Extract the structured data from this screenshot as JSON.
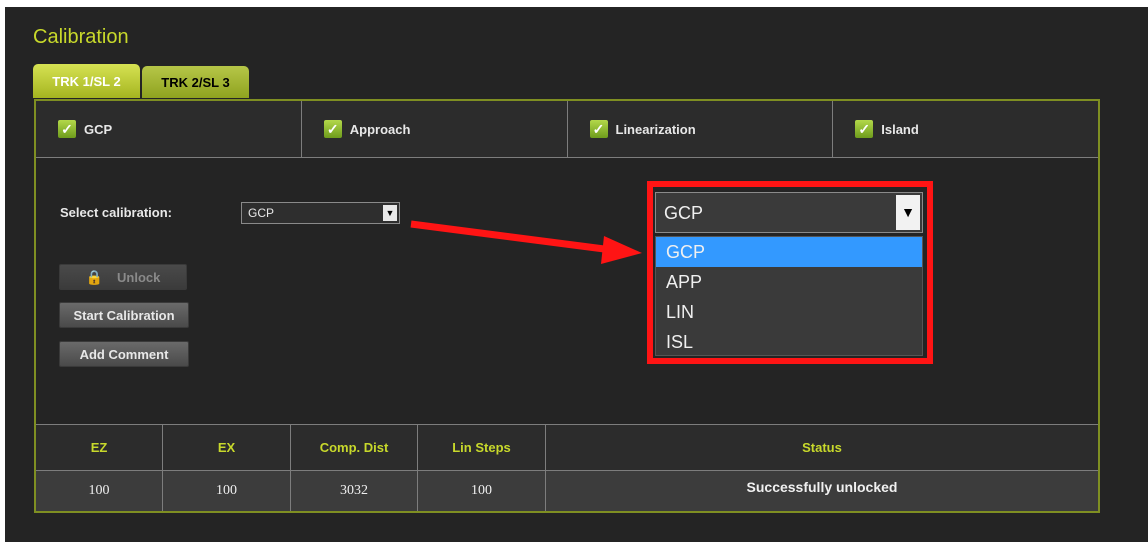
{
  "page": {
    "title": "Calibration"
  },
  "tabs": [
    {
      "label": "TRK 1/SL 2",
      "active": true
    },
    {
      "label": "TRK 2/SL 3",
      "active": false
    }
  ],
  "checks": [
    {
      "label": "GCP",
      "checked": true
    },
    {
      "label": "Approach",
      "checked": true
    },
    {
      "label": "Linearization",
      "checked": true
    },
    {
      "label": "Island",
      "checked": true
    }
  ],
  "select_calibration": {
    "label": "Select calibration:",
    "value": "GCP"
  },
  "buttons": {
    "unlock": "Unlock",
    "start": "Start Calibration",
    "comment": "Add Comment"
  },
  "dropdown": {
    "value": "GCP",
    "options": [
      "GCP",
      "APP",
      "LIN",
      "ISL"
    ],
    "selected_index": 0
  },
  "table": {
    "headers": [
      "EZ",
      "EX",
      "Comp. Dist",
      "Lin Steps",
      "Status"
    ],
    "row": [
      "100",
      "100",
      "3032",
      "100",
      "Successfully unlocked"
    ]
  },
  "colors": {
    "accent": "#c8d92b",
    "highlight": "#ff1414",
    "selected_option": "#3399ff"
  }
}
